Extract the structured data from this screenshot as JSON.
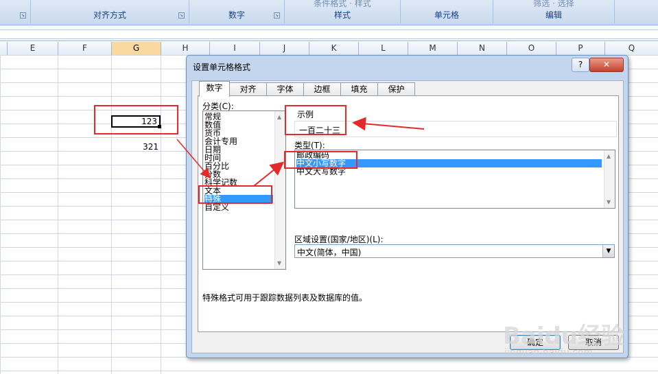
{
  "ribbon": {
    "groups": [
      {
        "label": "对齐方式",
        "cut": ""
      },
      {
        "label": "数字",
        "cut": ""
      },
      {
        "label": "样式",
        "cut": "条件格式 · 样式"
      },
      {
        "label": "单元格",
        "cut": ""
      },
      {
        "label": "编辑",
        "cut": "筛选 · 选择"
      }
    ],
    "launcher_glyph": "↘"
  },
  "sheet": {
    "columns": [
      "E",
      "F",
      "G",
      "H",
      "I",
      "J",
      "K",
      "L",
      "M",
      "N",
      "O",
      "P",
      "Q"
    ],
    "selected_column": "G",
    "cells": {
      "G_active": "123",
      "G_below": "321"
    }
  },
  "dialog": {
    "title": "设置单元格格式",
    "help_glyph": "?",
    "close_glyph": "✕",
    "tabs": [
      "数字",
      "对齐",
      "字体",
      "边框",
      "填充",
      "保护"
    ],
    "active_tab": "数字",
    "category_label": "分类(C):",
    "categories": [
      "常规",
      "数值",
      "货币",
      "会计专用",
      "日期",
      "时间",
      "百分比",
      "分数",
      "科学记数",
      "文本",
      "特殊",
      "自定义"
    ],
    "selected_category": "特殊",
    "sample_label": "示例",
    "sample_value": "一百二十三",
    "type_label": "类型(T):",
    "types": [
      "邮政编码",
      "中文小写数字",
      "中文大写数字"
    ],
    "selected_type": "中文小写数字",
    "locale_label": "区域设置(国家/地区)(L):",
    "locale_value": "中文(简体，中国)",
    "description": "特殊格式可用于跟踪数据列表及数据库的值。",
    "ok_label": "确定",
    "cancel_label": "取消"
  },
  "watermark": {
    "brand": "Baidu经验",
    "url": "jingyan.baidu.com"
  },
  "colors": {
    "annotation_red": "#e22a2a",
    "selection_blue": "#3399ff",
    "ribbon_text": "#15428b"
  }
}
